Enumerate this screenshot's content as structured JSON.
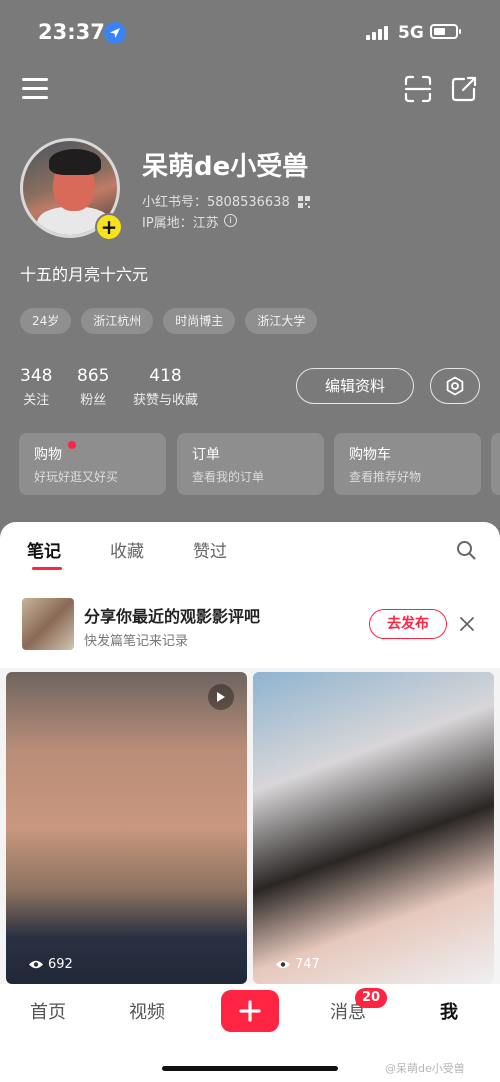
{
  "status_bar": {
    "time": "23:37",
    "network": "5G"
  },
  "profile": {
    "nickname": "呆萌de小受兽",
    "red_id_label": "小红书号：",
    "red_id": "5808536638",
    "ip_label": "IP属地：",
    "ip_location": "江苏",
    "bio": "十五的月亮十六元",
    "tags": [
      "24岁",
      "浙江杭州",
      "时尚博主",
      "浙江大学"
    ]
  },
  "stats": [
    {
      "value": "348",
      "label": "关注"
    },
    {
      "value": "865",
      "label": "粉丝"
    },
    {
      "value": "418",
      "label": "获赞与收藏"
    }
  ],
  "edit_profile_label": "编辑资料",
  "cards": [
    {
      "title": "购物",
      "subtitle": "好玩好逛又好买"
    },
    {
      "title": "订单",
      "subtitle": "查看我的订单"
    },
    {
      "title": "购物车",
      "subtitle": "查看推荐好物"
    }
  ],
  "tabs": [
    "笔记",
    "收藏",
    "赞过"
  ],
  "promo": {
    "title": "分享你最近的观影影评吧",
    "subtitle": "快发篇笔记来记录",
    "button_label": "去发布"
  },
  "notes": [
    {
      "views": "692"
    },
    {
      "views": "747"
    }
  ],
  "bottom_nav": {
    "home": "首页",
    "video": "视频",
    "messages": "消息",
    "messages_badge": "20",
    "me": "我"
  },
  "watermark": "@呆萌de小受兽",
  "colors": {
    "accent": "#ff2442",
    "badge_yellow": "#f7e21c",
    "header_bg": "#7a7a7a"
  },
  "icons": [
    "location-arrow-icon",
    "menu-icon",
    "scan-icon",
    "share-icon",
    "qr-code-icon",
    "info-icon",
    "gear-icon",
    "search-icon",
    "close-icon",
    "play-icon",
    "eye-icon",
    "plus-icon"
  ]
}
